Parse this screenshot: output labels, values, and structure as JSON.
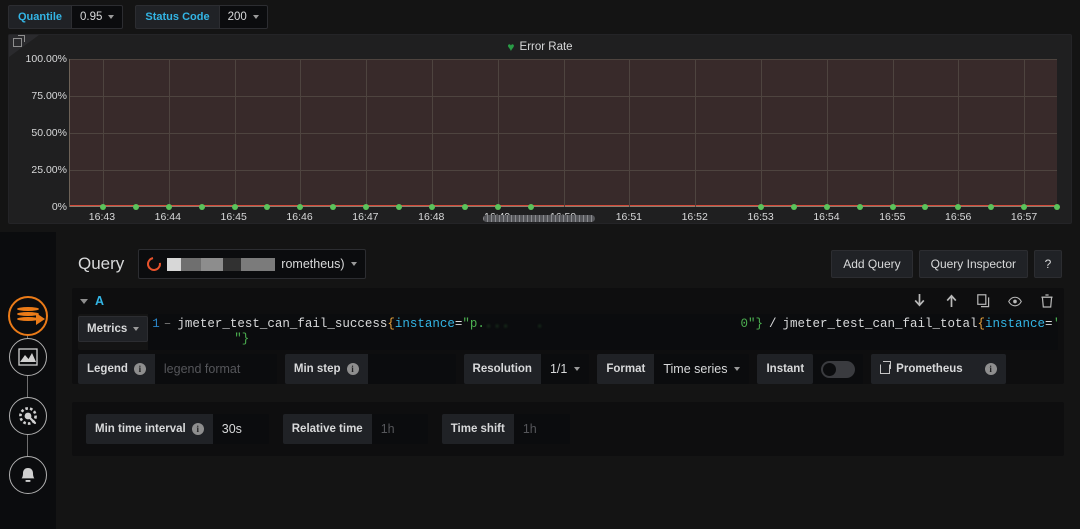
{
  "template_vars": [
    {
      "label": "Quantile",
      "value": "0.95"
    },
    {
      "label": "Status Code",
      "value": "200"
    }
  ],
  "panel": {
    "legend_label": "Error Rate",
    "legend_marker": "♥",
    "expand_icon": "external-link-icon"
  },
  "chart_data": {
    "type": "line",
    "title": "Error Rate",
    "xlabel": "",
    "ylabel": "",
    "ylim": [
      0,
      100
    ],
    "ytick_labels": [
      "0%",
      "25.00%",
      "50.00%",
      "75.00%",
      "100.00%"
    ],
    "ytick_values": [
      0,
      25,
      50,
      75,
      100
    ],
    "grid": true,
    "legend_position": "top-center",
    "series": [
      {
        "name": "Error Rate",
        "color": "#5ac35a",
        "line_color": "#d44a3a",
        "x": [
          "16:43",
          "16:44",
          "16:45",
          "16:46",
          "16:47",
          "16:48",
          "16:49",
          "16:50",
          "16:51",
          "16:52",
          "16:53",
          "16:54",
          "16:55",
          "16:56",
          "16:57"
        ],
        "values": [
          0,
          0,
          0,
          0,
          0,
          0,
          0,
          0,
          0,
          0,
          0,
          0,
          0,
          0,
          0
        ]
      }
    ],
    "xtick_labels": [
      "16:43",
      "16:44",
      "16:45",
      "16:46",
      "16:47",
      "16:48",
      "16:49",
      "16:50",
      "16:51",
      "16:52",
      "16:53",
      "16:54",
      "16:55",
      "16:56",
      "16:57"
    ]
  },
  "sidebar": {
    "items": [
      {
        "name": "grafana-logo",
        "label": "Grafana"
      },
      {
        "name": "dashboards-icon",
        "label": "Dashboards"
      },
      {
        "name": "configuration-icon",
        "label": "Configuration"
      },
      {
        "name": "alerting-icon",
        "label": "Alerting"
      }
    ]
  },
  "query": {
    "title": "Query",
    "datasource_suffix": "rometheus)",
    "datasource_redacted": true,
    "add_query_label": "Add Query",
    "query_inspector_label": "Query Inspector",
    "help_label": "?",
    "ref_id": "A",
    "actions": [
      "move-down-icon",
      "move-up-icon",
      "duplicate-icon",
      "toggle-visibility-icon",
      "remove-icon"
    ],
    "metrics_label": "Metrics",
    "line_number": "1",
    "fold_marker": "–",
    "expression": {
      "numerator_metric": "jmeter_test_can_fail_success",
      "numerator_label": "instance",
      "numerator_value_visible": "\"p.",
      "numerator_tail": "0\"}",
      "operator": "/",
      "denominator_metric": "jmeter_test_can_fail_total",
      "denominator_label": "instance",
      "denominator_value_visible": "'",
      "line2_fragment": "\"}",
      "trailing": ")–"
    },
    "options": {
      "legend_label": "Legend",
      "legend_placeholder": "legend format",
      "legend_value": "",
      "min_step_label": "Min step",
      "min_step_value": "",
      "resolution_label": "Resolution",
      "resolution_value": "1/1",
      "format_label": "Format",
      "format_value": "Time series",
      "instant_label": "Instant",
      "instant_enabled": false,
      "prometheus_link_label": "Prometheus"
    }
  },
  "panel_options": {
    "min_time_interval_label": "Min time interval",
    "min_time_interval_value": "30s",
    "relative_time_label": "Relative time",
    "relative_time_placeholder": "1h",
    "relative_time_value": "",
    "time_shift_label": "Time shift",
    "time_shift_placeholder": "1h",
    "time_shift_value": ""
  },
  "colors": {
    "accent_blue": "#33b5e5",
    "brand_orange": "#eb7b18",
    "series_green": "#5ac35a",
    "series_red": "#d44a3a",
    "plot_fill": "#382a2a"
  }
}
